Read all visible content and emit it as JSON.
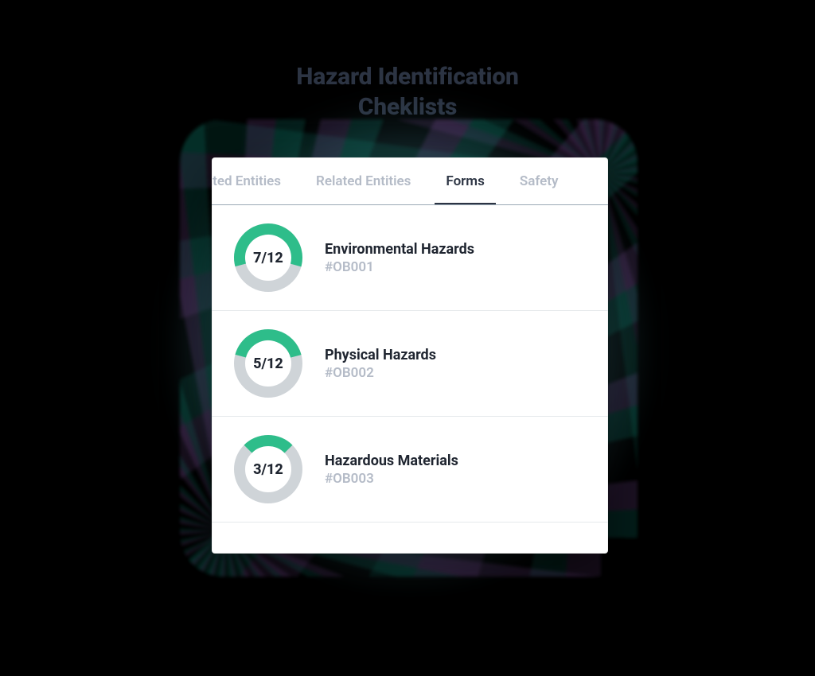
{
  "heading": {
    "line1": "Hazard Identification",
    "line2": "Cheklists"
  },
  "tabs": {
    "partial_left": "ated Entities",
    "related": "Related Entities",
    "forms": "Forms",
    "safety_partial": "Safety",
    "active_index": 2
  },
  "ring_total": 12,
  "rows": [
    {
      "count": 7,
      "total": 12,
      "label": "7/12",
      "title": "Environmental Hazards",
      "code": "#OB001",
      "arc_deg": 210
    },
    {
      "count": 5,
      "total": 12,
      "label": "5/12",
      "title": "Physical Hazards",
      "code": "#OB002",
      "arc_deg": 150
    },
    {
      "count": 3,
      "total": 12,
      "label": "3/12",
      "title": "Hazardous Materials",
      "code": "#OB003",
      "arc_deg": 90
    }
  ],
  "colors": {
    "ring_fg": "#2ebd8a",
    "ring_bg": "#cfd4d8",
    "text_dark": "#1f2530",
    "text_muted": "#b4bbc7"
  }
}
